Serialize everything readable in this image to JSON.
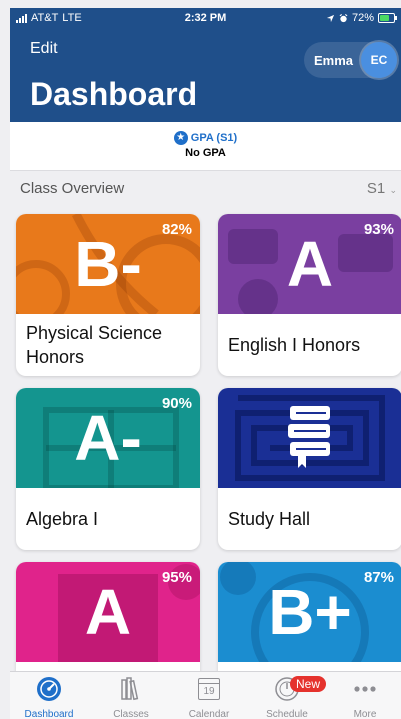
{
  "status_bar": {
    "carrier": "AT&T",
    "network": "LTE",
    "time": "2:32 PM",
    "battery": "72%",
    "battery_level": 0.72
  },
  "header": {
    "edit_label": "Edit",
    "user_name": "Emma",
    "avatar_initials": "EC",
    "title": "Dashboard"
  },
  "gpa": {
    "label": "GPA (S1)",
    "value": "No GPA"
  },
  "overview": {
    "title": "Class Overview",
    "term": "S1"
  },
  "classes": [
    {
      "grade": "B-",
      "percent": "82%",
      "name": "Physical Science Honors",
      "color": "#e8791b"
    },
    {
      "grade": "A",
      "percent": "93%",
      "name": "English I Honors",
      "color": "#7a3fa0"
    },
    {
      "grade": "A-",
      "percent": "90%",
      "name": "Algebra I",
      "color": "#14958f"
    },
    {
      "grade": "",
      "percent": "",
      "name": "Study Hall",
      "color": "#1a2f95"
    },
    {
      "grade": "A",
      "percent": "95%",
      "name": "",
      "color": "#e0238b"
    },
    {
      "grade": "B+",
      "percent": "87%",
      "name": "",
      "color": "#1b8dd0"
    }
  ],
  "tabs": [
    {
      "label": "Dashboard",
      "icon": "dashboard-gauge-icon",
      "active": true
    },
    {
      "label": "Classes",
      "icon": "books-icon",
      "active": false
    },
    {
      "label": "Calendar",
      "icon": "calendar-icon",
      "active": false,
      "day": "19"
    },
    {
      "label": "Schedule",
      "icon": "clock-icon",
      "active": false,
      "badge": "New"
    },
    {
      "label": "More",
      "icon": "more-dots-icon",
      "active": false
    }
  ],
  "colors": {
    "header": "#1f4f8a",
    "accent": "#1f6fc9",
    "badge": "#e5322d"
  }
}
